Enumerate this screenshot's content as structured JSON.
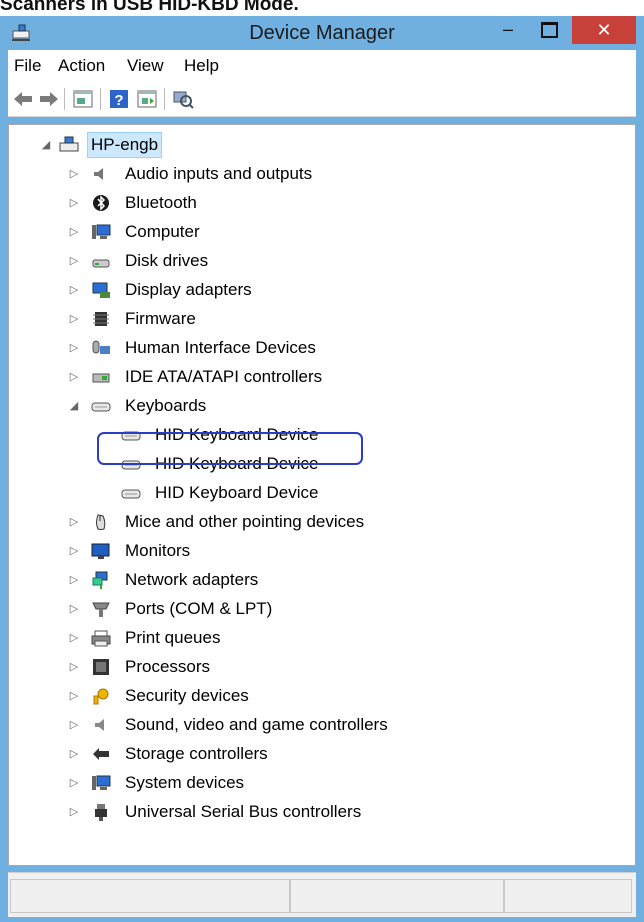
{
  "caption": "Scanners in USB HID-KBD Mode.",
  "window": {
    "title": "Device Manager"
  },
  "menu": [
    "File",
    "Action",
    "View",
    "Help"
  ],
  "toolbar": {
    "icons": [
      "back-icon",
      "forward-icon",
      "properties-icon",
      "help-icon",
      "update-driver-icon",
      "scan-hardware-icon"
    ]
  },
  "tree": {
    "root": "HP-engb",
    "categories": [
      {
        "label": "Audio inputs and outputs",
        "icon": "speaker-icon",
        "expanded": false
      },
      {
        "label": "Bluetooth",
        "icon": "bluetooth-icon",
        "expanded": false
      },
      {
        "label": "Computer",
        "icon": "computer-icon",
        "expanded": false
      },
      {
        "label": "Disk drives",
        "icon": "disk-drive-icon",
        "expanded": false
      },
      {
        "label": "Display adapters",
        "icon": "display-adapter-icon",
        "expanded": false
      },
      {
        "label": "Firmware",
        "icon": "firmware-icon",
        "expanded": false
      },
      {
        "label": "Human Interface Devices",
        "icon": "hid-icon",
        "expanded": false
      },
      {
        "label": "IDE ATA/ATAPI controllers",
        "icon": "ide-controller-icon",
        "expanded": false
      },
      {
        "label": "Keyboards",
        "icon": "keyboard-icon",
        "expanded": true,
        "children": [
          "HID Keyboard Device",
          "HID Keyboard Device",
          "HID Keyboard Device"
        ]
      },
      {
        "label": "Mice and other pointing devices",
        "icon": "mouse-icon",
        "expanded": false
      },
      {
        "label": "Monitors",
        "icon": "monitor-icon",
        "expanded": false
      },
      {
        "label": "Network adapters",
        "icon": "network-adapter-icon",
        "expanded": false
      },
      {
        "label": "Ports (COM & LPT)",
        "icon": "port-icon",
        "expanded": false
      },
      {
        "label": "Print queues",
        "icon": "printer-icon",
        "expanded": false
      },
      {
        "label": "Processors",
        "icon": "processor-icon",
        "expanded": false
      },
      {
        "label": "Security devices",
        "icon": "security-key-icon",
        "expanded": false
      },
      {
        "label": "Sound, video and game controllers",
        "icon": "sound-controller-icon",
        "expanded": false
      },
      {
        "label": "Storage controllers",
        "icon": "storage-controller-icon",
        "expanded": false
      },
      {
        "label": "System devices",
        "icon": "system-devices-icon",
        "expanded": false
      },
      {
        "label": "Universal Serial Bus controllers",
        "icon": "usb-icon",
        "expanded": false
      }
    ]
  },
  "colors": {
    "titlebar": "#6fb0e0",
    "close": "#c7403a",
    "selection": "#cce8ff",
    "highlight": "#2b3dc4"
  }
}
